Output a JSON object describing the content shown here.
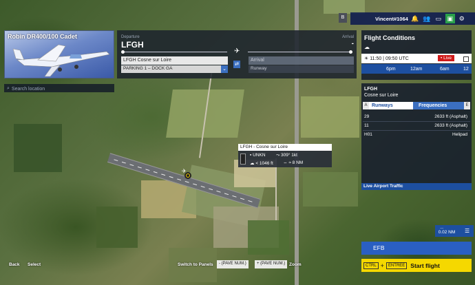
{
  "aircraft": {
    "name": "Robin DR400/100 Cadet"
  },
  "search": {
    "placeholder": "Search location"
  },
  "route": {
    "departure_label": "Departure",
    "departure_code": "LFGH",
    "departure_field": "LFGH Cosne sur Loire",
    "departure_parking": "PARKING 1 – DOCK GA",
    "arrival_label": "Arrival",
    "arrival_code": "-",
    "arrival_field_placeholder": "Arrival",
    "arrival_runway_placeholder": "Runway"
  },
  "topbar": {
    "b_label": "B",
    "username": "Vincent#1064"
  },
  "flight_conditions": {
    "title": "Flight Conditions",
    "time": "11:50 | 09:50 UTC",
    "live_label": "• Live",
    "scale": [
      "6pm",
      "12am",
      "6am",
      "12"
    ]
  },
  "airport": {
    "code": "LFGH",
    "name": "Cosne sur Loire",
    "tab_left_key": "A",
    "tab_runways": "Runways",
    "tab_frequencies": "Frequencies",
    "tab_right_key": "E",
    "runways": [
      {
        "id": "29",
        "info": "2633 ft (Asphalt)"
      },
      {
        "id": "11",
        "info": "2633 ft (Asphalt)"
      },
      {
        "id": "H01",
        "info": "Helipad"
      }
    ],
    "live_traffic": "Live Airport Traffic"
  },
  "tooltip": {
    "title": "LFGH - Cosne sur Loire",
    "type": "UNKN",
    "wind": "309° 1kt",
    "elevation": "< 1046 ft",
    "distance": "≈ 8 NM"
  },
  "map_tools": {
    "zoom": "0.02 NM"
  },
  "efb": {
    "label": "EFB"
  },
  "start": {
    "key1": "CTRL",
    "plus": "+",
    "key2": "ENTREE",
    "label": "Start flight"
  },
  "bottom": {
    "back": "Back",
    "select": "Select",
    "switch_panels": "Switch to Panels",
    "zoom_out_key": "- (PAVE NUM.)",
    "zoom_in_key": "+ (PAVE NUM.)",
    "zoom_label": "Zoom"
  }
}
